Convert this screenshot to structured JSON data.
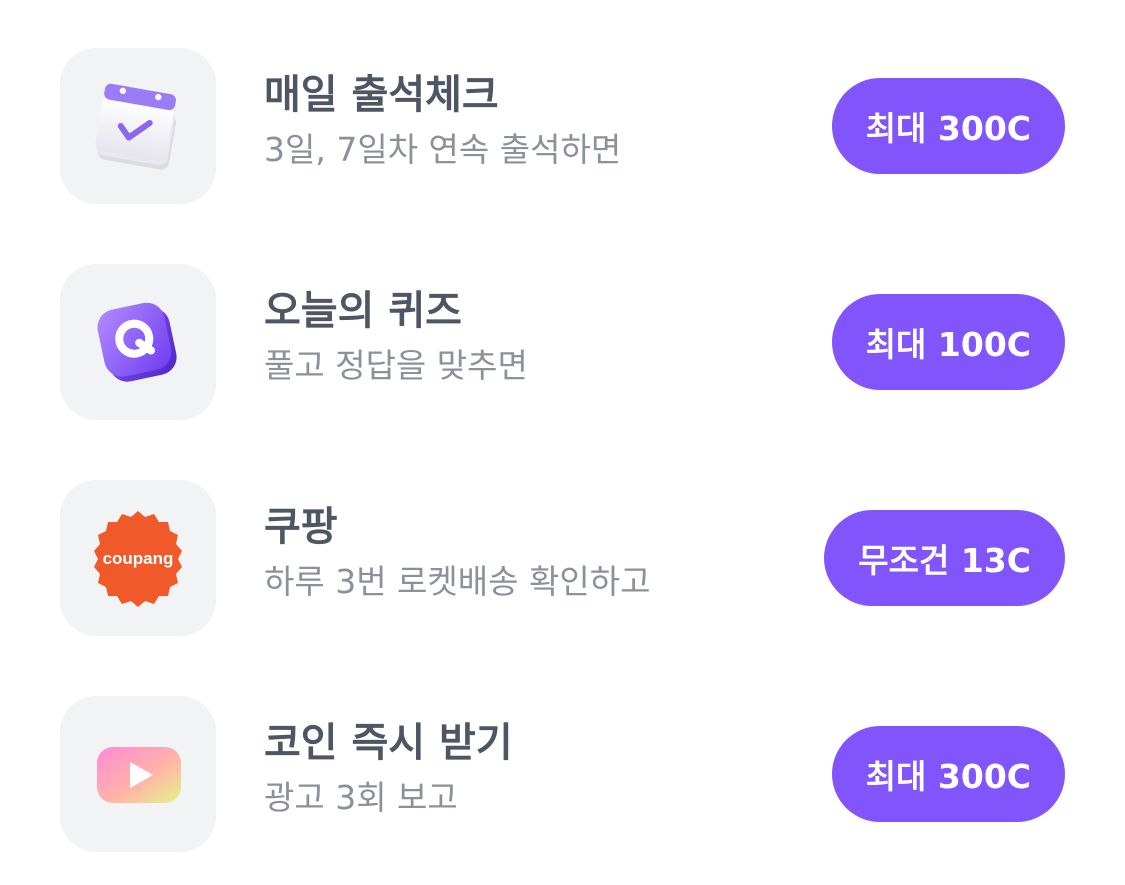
{
  "items": [
    {
      "icon": "calendar-check-icon",
      "title": "매일 출석체크",
      "subtitle": "3일, 7일차 연속 출석하면",
      "reward": "최대 300C"
    },
    {
      "icon": "quiz-q-icon",
      "title": "오늘의 퀴즈",
      "subtitle": "풀고 정답을 맞추면",
      "reward": "최대 100C"
    },
    {
      "icon": "coupang-logo",
      "logo_text": "coupang",
      "title": "쿠팡",
      "subtitle": "하루 3번 로켓배송 확인하고",
      "reward": "무조건 13C"
    },
    {
      "icon": "play-video-icon",
      "title": "코인 즉시 받기",
      "subtitle": "광고 3회 보고",
      "reward": "최대 300C"
    }
  ],
  "colors": {
    "accent": "#8155fb",
    "title": "#4e5563",
    "subtitle": "#8b919b",
    "tile": "#f2f3f5",
    "coupang": "#f05a2a"
  }
}
